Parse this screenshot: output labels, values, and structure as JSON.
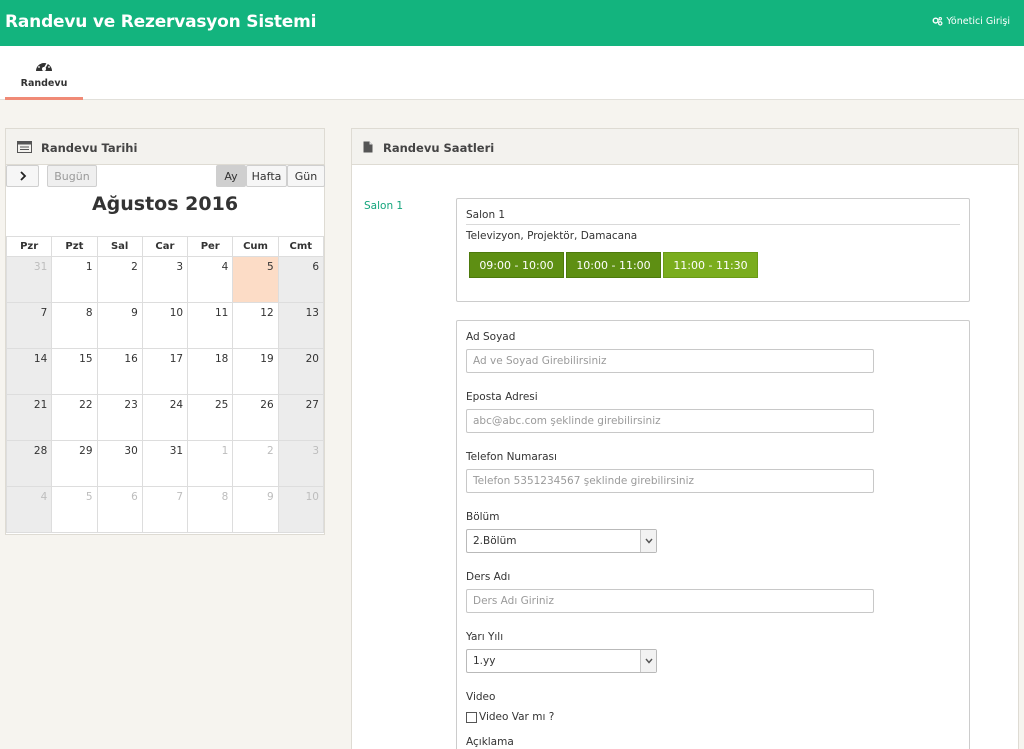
{
  "header": {
    "title": "Randevu ve Rezervasyon Sistemi",
    "admin_link": "Yönetici Girişi"
  },
  "nav": {
    "tab_label": "Randevu"
  },
  "calendar_panel": {
    "title": "Randevu Tarihi",
    "today_button": "Bugün",
    "views": [
      "Ay",
      "Hafta",
      "Gün"
    ],
    "active_view": "Ay",
    "month_title": "Ağustos 2016",
    "weekdays": [
      "Pzr",
      "Pzt",
      "Sal",
      "Car",
      "Per",
      "Cum",
      "Cmt"
    ],
    "weeks": [
      [
        "31",
        "1",
        "2",
        "3",
        "4",
        "5",
        "6"
      ],
      [
        "7",
        "8",
        "9",
        "10",
        "11",
        "12",
        "13"
      ],
      [
        "14",
        "15",
        "16",
        "17",
        "18",
        "19",
        "20"
      ],
      [
        "21",
        "22",
        "23",
        "24",
        "25",
        "26",
        "27"
      ],
      [
        "28",
        "29",
        "30",
        "31",
        "1",
        "2",
        "3"
      ],
      [
        "4",
        "5",
        "6",
        "7",
        "8",
        "9",
        "10"
      ]
    ]
  },
  "hours_panel": {
    "title": "Randevu Saatleri",
    "salon_link": "Salon 1",
    "salon": {
      "name": "Salon 1",
      "equipment": "Televizyon, Projektör, Damacana",
      "slots": [
        "09:00 - 10:00",
        "10:00 - 11:00",
        "11:00 - 11:30"
      ]
    },
    "form": {
      "name_label": "Ad Soyad",
      "name_placeholder": "Ad ve Soyad Girebilirsiniz",
      "email_label": "Eposta Adresi",
      "email_placeholder": "abc@abc.com şeklinde girebilirsiniz",
      "phone_label": "Telefon Numarası",
      "phone_placeholder": "Telefon 5351234567 şeklinde girebilirsiniz",
      "department_label": "Bölüm",
      "department_value": "2.Bölüm",
      "course_label": "Ders Adı",
      "course_placeholder": "Ders Adı Giriniz",
      "semester_label": "Yarı Yılı",
      "semester_value": "1.yy",
      "video_label": "Video",
      "video_checkbox_label": "Video Var mı ?",
      "description_label": "Açıklama"
    }
  },
  "colors": {
    "header_bg": "#13b47e",
    "slot_dark": "#5e8f13",
    "slot_light": "#7aad1e",
    "today_bg": "#fcdcc6",
    "nav_underline": "#f08a76"
  }
}
